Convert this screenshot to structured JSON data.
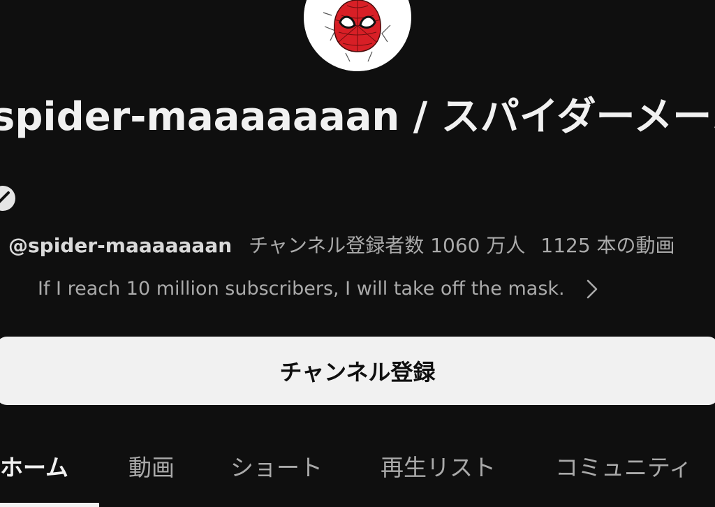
{
  "channel": {
    "title": "spider-maaaaaaan / スパイダーメーン",
    "handle": "@spider-maaaaaaan",
    "subscribers": "チャンネル登録者数 1060 万人",
    "video_count": "1125 本の動画",
    "description": "If I reach 10 million subscribers, I will take off the mask."
  },
  "subscribe": {
    "label": "チャンネル登録"
  },
  "tabs": [
    {
      "label": "ホーム",
      "active": true
    },
    {
      "label": "動画",
      "active": false
    },
    {
      "label": "ショート",
      "active": false
    },
    {
      "label": "再生リスト",
      "active": false
    },
    {
      "label": "コミュニティ",
      "active": false
    }
  ],
  "icons": {
    "avatar": "spider-mask-avatar",
    "badge": "edit-pencil-icon",
    "description_more": "chevron-right-icon"
  },
  "colors": {
    "background": "#0f0f0f",
    "primary_text": "#f1f1f1",
    "secondary_text": "#aaaaaa",
    "button_bg": "#f1f1f1",
    "button_text": "#0f0f0f",
    "mask_red": "#d81f26"
  }
}
